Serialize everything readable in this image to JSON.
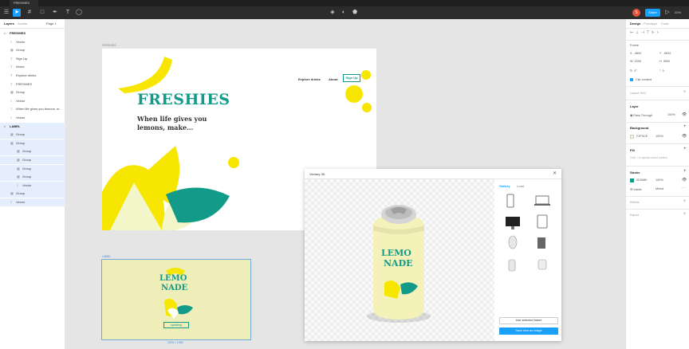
{
  "tabbar": {
    "tab_label": "FRESHIES"
  },
  "toolbar": {
    "share_label": "Share",
    "zoom": "20%",
    "avatar": "S"
  },
  "left_panel": {
    "tabs": [
      "Layers",
      "Assets"
    ],
    "page": "Page 1",
    "layers": [
      {
        "name": "FRESHIES",
        "indent": 0,
        "icon": "#"
      },
      {
        "name": "Vector",
        "indent": 1,
        "icon": "⌇"
      },
      {
        "name": "Group",
        "indent": 1,
        "icon": "▦"
      },
      {
        "name": "Sign Up",
        "indent": 1,
        "icon": "T"
      },
      {
        "name": "About",
        "indent": 1,
        "icon": "T"
      },
      {
        "name": "Explore drinks",
        "indent": 1,
        "icon": "T"
      },
      {
        "name": "FRESHIES",
        "indent": 1,
        "icon": "T"
      },
      {
        "name": "Group",
        "indent": 1,
        "icon": "▦"
      },
      {
        "name": "Vector",
        "indent": 1,
        "icon": "⌇"
      },
      {
        "name": "When life gives you lemons, m...",
        "indent": 1,
        "icon": "T"
      },
      {
        "name": "Vector",
        "indent": 1,
        "icon": "⌇"
      },
      {
        "name": "LABEL",
        "indent": 0,
        "icon": "#",
        "selected": true
      },
      {
        "name": "Group",
        "indent": 1,
        "icon": "▦",
        "selected": true
      },
      {
        "name": "Group",
        "indent": 1,
        "icon": "▦",
        "selected": true
      },
      {
        "name": "Group",
        "indent": 2,
        "icon": "▦",
        "selected": true
      },
      {
        "name": "Group",
        "indent": 2,
        "icon": "▦",
        "selected": true
      },
      {
        "name": "Group",
        "indent": 2,
        "icon": "▦",
        "selected": true
      },
      {
        "name": "Group",
        "indent": 2,
        "icon": "▦",
        "selected": true
      },
      {
        "name": "Vector",
        "indent": 2,
        "icon": "⌇",
        "selected": true
      },
      {
        "name": "Group",
        "indent": 1,
        "icon": "▦",
        "selected": true
      },
      {
        "name": "Vector",
        "indent": 1,
        "icon": "⌇",
        "selected": true
      }
    ]
  },
  "canvas": {
    "frame1_label": "FRESHIES",
    "frame2_label": "LABEL",
    "frame2_size": "1920 × 1080",
    "nav": [
      "Explore drinks",
      "About",
      "Sign Up"
    ],
    "brand": "FRESHIES",
    "tagline_1": "When life gives you",
    "tagline_2": "lemons, make...",
    "label_line1": "LEMO",
    "label_line2": "NADE",
    "label_badge": "sparkling"
  },
  "modal": {
    "title": "Vectary 3D",
    "tabs": [
      "Gallery",
      "Load"
    ],
    "can_line1": "LEMO",
    "can_line2": "NADE",
    "use_frame_label": "Use selected frame",
    "save_label": "Save new as image"
  },
  "right_panel": {
    "tabs": [
      "Design",
      "Prototype",
      "Code"
    ],
    "frame_label": "Frame",
    "x": "-3800",
    "y": "-9632",
    "w": "2200",
    "h": "5052",
    "rotation": "0°",
    "radius": "0",
    "clip_label": "Clip content",
    "layout_grid": "Layout Grid",
    "layer_heading": "Layer",
    "blend": "Pass Through",
    "layer_opacity": "100%",
    "background_heading": "Background",
    "bg_hex": "F2F9CE",
    "bg_opacity": "100%",
    "fill_heading": "Fill",
    "fill_hint": "Click + to replace mixed content",
    "stroke_heading": "Stroke",
    "stroke_hex": "0D0980",
    "stroke_opacity": "100%",
    "stroke_side": "Inside",
    "stroke_weight": "Mixed",
    "effects_heading": "Effects",
    "export_heading": "Export"
  },
  "colors": {
    "accent": "#18a0fb",
    "teal": "#139b8a",
    "lemon": "#f6e600",
    "dark": "#2c2c2c"
  }
}
